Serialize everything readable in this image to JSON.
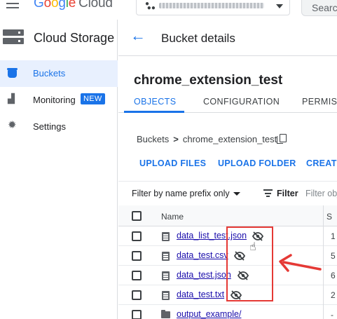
{
  "header": {
    "logo_letters": [
      "G",
      "o",
      "o",
      "g",
      "l",
      "e"
    ],
    "logo_suffix": "Cloud",
    "search_placeholder": "Searc"
  },
  "sidebar": {
    "title": "Cloud Storage",
    "items": [
      {
        "label": "Buckets",
        "icon": "bucket-icon",
        "active": true
      },
      {
        "label": "Monitoring",
        "icon": "monitoring-icon",
        "badge": "NEW"
      },
      {
        "label": "Settings",
        "icon": "gear-icon"
      }
    ]
  },
  "main": {
    "page_title": "Bucket details",
    "bucket_name": "chrome_extension_test",
    "tabs": [
      {
        "label": "OBJECTS",
        "active": true
      },
      {
        "label": "CONFIGURATION"
      },
      {
        "label": "PERMISSI"
      }
    ],
    "breadcrumb": {
      "root": "Buckets",
      "separator": ">",
      "current": "chrome_extension_test"
    },
    "actions": [
      "UPLOAD FILES",
      "UPLOAD FOLDER",
      "CREATE"
    ],
    "filter": {
      "select_label": "Filter by name prefix only",
      "filter_label": "Filter",
      "input_placeholder": "Filter obj"
    },
    "table": {
      "columns": [
        "Name",
        "S"
      ],
      "rows": [
        {
          "name": "data_list_test.json",
          "type": "file",
          "col2": "1",
          "public_access_hidden": true
        },
        {
          "name": "data_test.csv",
          "type": "file",
          "col2": "5",
          "public_access_hidden": true
        },
        {
          "name": "data_test.json",
          "type": "file",
          "col2": "6",
          "public_access_hidden": true
        },
        {
          "name": "data_test.txt",
          "type": "file",
          "col2": "2",
          "public_access_hidden": true
        },
        {
          "name": "output_example/",
          "type": "folder",
          "col2": "-"
        }
      ]
    }
  },
  "colors": {
    "accent": "#1a73e8",
    "highlight": "#e53935",
    "active_nav_bg": "#e8f0fe"
  }
}
